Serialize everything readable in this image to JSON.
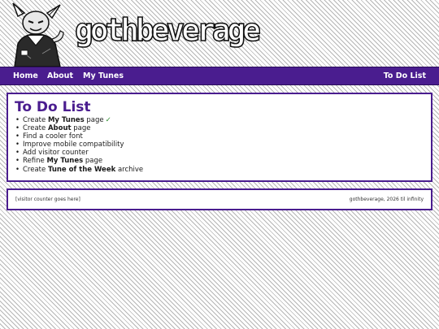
{
  "header": {
    "logo_text": "gothbeverage"
  },
  "nav": {
    "home": "Home",
    "about": "About",
    "my_tunes": "My Tunes",
    "to_do_list": "To Do List"
  },
  "main": {
    "title": "To Do List",
    "items": [
      {
        "prefix": "Create ",
        "bold": "My Tunes",
        "suffix": " page",
        "done": true,
        "check": "✓"
      },
      {
        "prefix": "Create ",
        "bold": "About",
        "suffix": " page",
        "done": false,
        "check": ""
      },
      {
        "prefix": "Find a cooler font",
        "bold": "",
        "suffix": "",
        "done": false,
        "check": ""
      },
      {
        "prefix": "Improve mobile compatibility",
        "bold": "",
        "suffix": "",
        "done": false,
        "check": ""
      },
      {
        "prefix": "Add visitor counter",
        "bold": "",
        "suffix": "",
        "done": false,
        "check": ""
      },
      {
        "prefix": "Refine ",
        "bold": "My Tunes",
        "suffix": " page",
        "done": false,
        "check": ""
      },
      {
        "prefix": "Create ",
        "bold": "Tune of the Week",
        "suffix": " archive",
        "done": false,
        "check": ""
      }
    ]
  },
  "footer": {
    "counter_placeholder": "[visitor counter goes here]",
    "copyright": "gothbeverage, 2026 til infinity"
  },
  "colors": {
    "accent": "#4a1d8f",
    "check": "#2a8a2a"
  }
}
